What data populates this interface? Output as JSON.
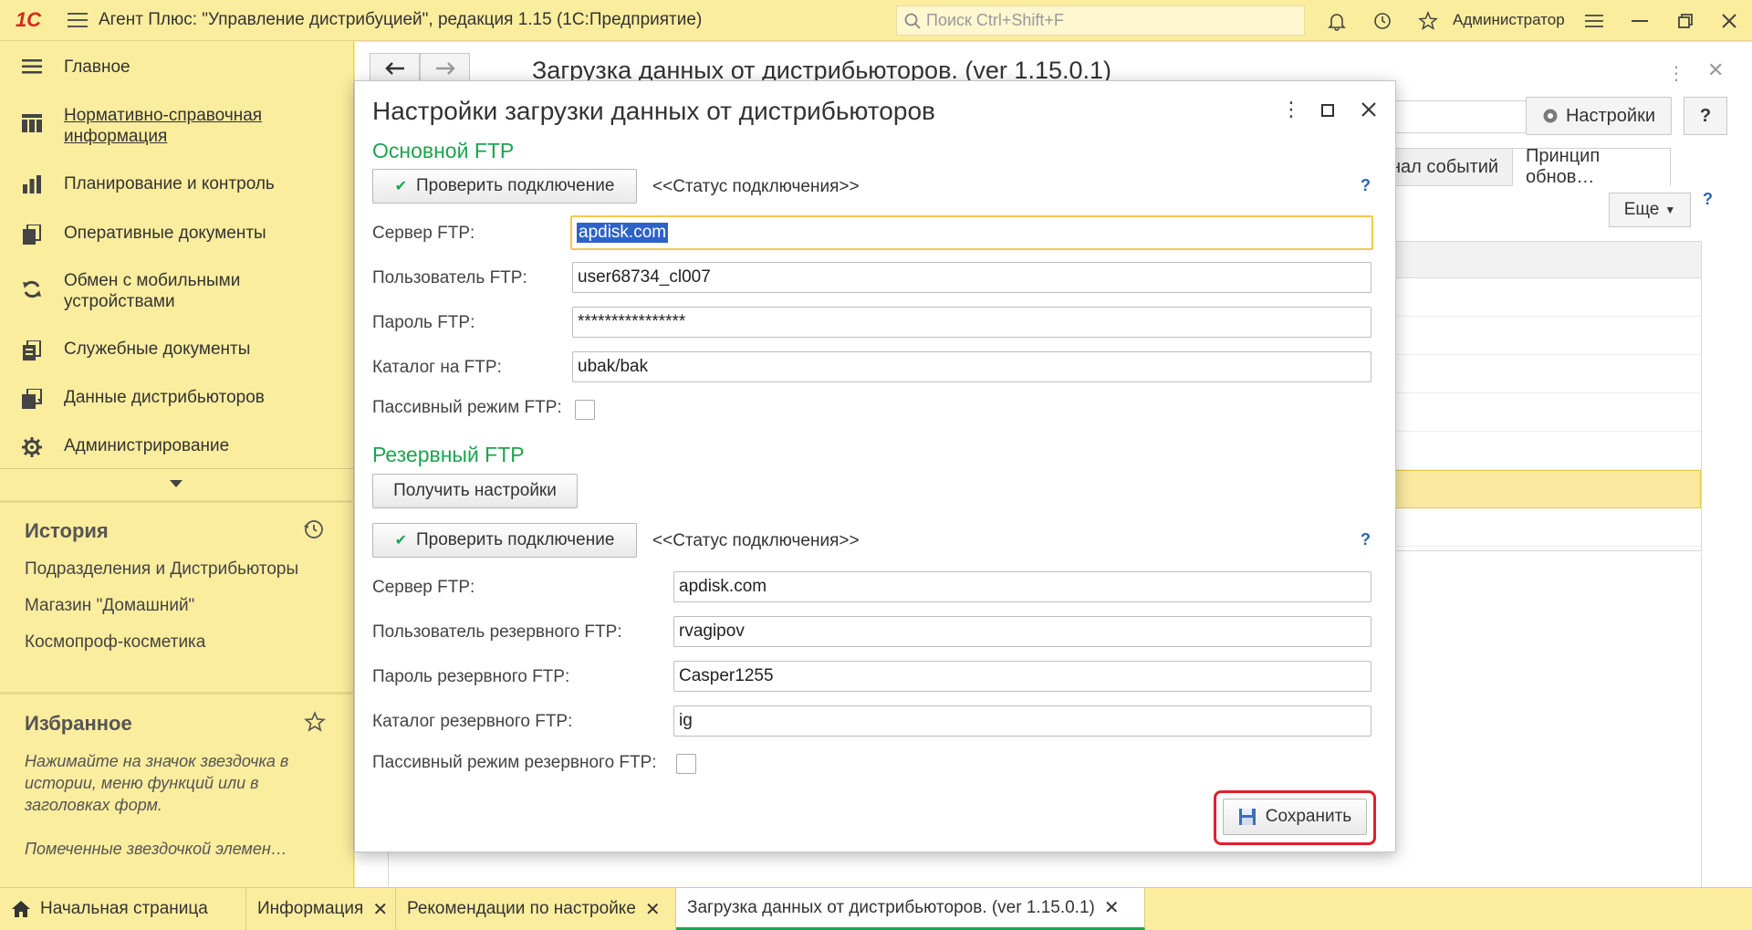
{
  "app": {
    "logo": "1С",
    "title": "Агент Плюс: \"Управление дистрибуцией\", редакция 1.15  (1С:Предприятие)",
    "search_placeholder": "Поиск Ctrl+Shift+F",
    "user": "Администратор"
  },
  "sidebar": {
    "items": [
      {
        "label": "Главное",
        "icon": "menu-lines-icon"
      },
      {
        "label": "Нормативно-справочная информация",
        "icon": "catalog-icon"
      },
      {
        "label": "Планирование и контроль",
        "icon": "bar-chart-icon"
      },
      {
        "label": "Оперативные документы",
        "icon": "documents-icon"
      },
      {
        "label": "Обмен с мобильными устройствами",
        "icon": "sync-icon"
      },
      {
        "label": "Служебные документы",
        "icon": "service-docs-icon"
      },
      {
        "label": "Данные дистрибьюторов",
        "icon": "distributor-data-icon"
      },
      {
        "label": "Администрирование",
        "icon": "gear-icon"
      }
    ],
    "history_title": "История",
    "history_items": [
      "Подразделения и Дистрибьюторы",
      "Магазин \"Домашний\"",
      "Космопроф-косметика"
    ],
    "favorites_title": "Избранное",
    "favorites_hint": "Нажимайте на значок звездочка в истории, меню функций или в заголовках форм.",
    "favorites_hint2": "Помеченные звездочкой элемен…"
  },
  "main": {
    "title": "Загрузка данных от дистрибьюторов. (ver 1.15.0.1)",
    "settings_button": "Настройки",
    "help_button": "?",
    "tabs": [
      "нал событий",
      "Принцип обнов…"
    ],
    "more_button": "Еще",
    "more_help": "?"
  },
  "dialog": {
    "title": "Настройки загрузки данных от дистрибьюторов",
    "primary": {
      "group_title": "Основной FTP",
      "check_button": "Проверить подключение",
      "status": "<<Статус подключения>>",
      "help": "?",
      "server_label": "Сервер FTP:",
      "server_value": "apdisk.com",
      "user_label": "Пользователь FTP:",
      "user_value": "user68734_cl007",
      "password_label": "Пароль FTP:",
      "password_value": "****************",
      "catalog_label": "Каталог на FTP:",
      "catalog_value": "ubak/bak",
      "passive_label": "Пассивный режим FTP:",
      "passive_checked": false
    },
    "backup": {
      "group_title": "Резервный FTP",
      "get_settings_button": "Получить настройки",
      "check_button": "Проверить подключение",
      "status": "<<Статус подключения>>",
      "help": "?",
      "server_label": "Сервер FTP:",
      "server_value": "apdisk.com",
      "user_label": "Пользователь резервного FTP:",
      "user_value": "rvagipov",
      "password_label": "Пароль резервного FTP:",
      "password_value": "Casper1255",
      "catalog_label": "Каталог резервного FTP:",
      "catalog_value": "ig",
      "passive_label": "Пассивный режим резервного FTP:",
      "passive_checked": false
    },
    "save_button": "Сохранить"
  },
  "bottom_tabs": [
    {
      "label": "Начальная страница",
      "closable": false
    },
    {
      "label": "Информация",
      "closable": true
    },
    {
      "label": "Рекомендации по настройке",
      "closable": true
    },
    {
      "label": "Загрузка данных от дистрибьюторов. (ver 1.15.0.1)",
      "closable": true,
      "active": true
    }
  ],
  "colors": {
    "panel": "#fbed9e",
    "group_title": "#1ba54f",
    "focus_border": "#f2c94c",
    "highlight": "#e0202a",
    "link_blue": "#2a64b0"
  }
}
